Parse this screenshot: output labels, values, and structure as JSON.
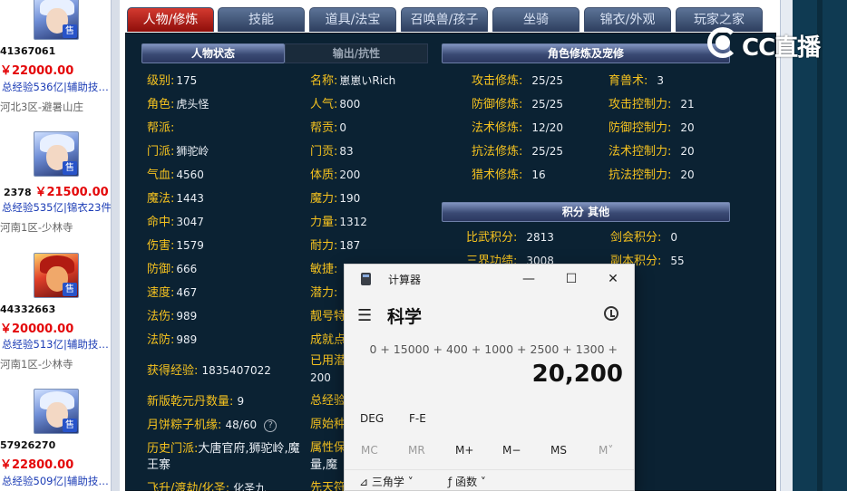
{
  "listings": [
    {
      "id": "41367061",
      "price": "￥22000.00",
      "exp": "总经验536亿|辅助技…",
      "server": "河北3区-避暑山庄",
      "badge": "售"
    },
    {
      "id": "2378",
      "price": "￥21500.00",
      "exp": "总经验535亿|锦衣23件",
      "server": "河南1区-少林寺",
      "badge": "售"
    },
    {
      "id": "44332663",
      "price": "￥20000.00",
      "exp": "总经验513亿|辅助技…",
      "server": "河南1区-少林寺",
      "badge": "售"
    },
    {
      "id": "57926270",
      "price": "￥22800.00",
      "exp": "总经验509亿|辅助技…",
      "server": "",
      "badge": "售"
    }
  ],
  "tabs": [
    "人物/修炼",
    "技能",
    "道具/法宝",
    "召唤兽/孩子",
    "坐骑",
    "锦衣/外观",
    "玩家之家"
  ],
  "sections": {
    "status": "人物状态",
    "output": "输出/抗性",
    "cultivation": "角色修炼及宠修",
    "points": "积分 其他"
  },
  "status_left": [
    {
      "k": "级别:",
      "v": "175"
    },
    {
      "k": "角色:",
      "v": "虎头怪"
    },
    {
      "k": "帮派:",
      "v": ""
    },
    {
      "k": "门派:",
      "v": "狮驼岭"
    },
    {
      "k": "气血:",
      "v": "4560"
    },
    {
      "k": "魔法:",
      "v": "1443"
    },
    {
      "k": "命中:",
      "v": "3047"
    },
    {
      "k": "伤害:",
      "v": "1579"
    },
    {
      "k": "防御:",
      "v": "666"
    },
    {
      "k": "速度:",
      "v": "467"
    },
    {
      "k": "法伤:",
      "v": "989"
    },
    {
      "k": "法防:",
      "v": "989"
    }
  ],
  "status_right": [
    {
      "k": "名称:",
      "v": "崽崽いRich"
    },
    {
      "k": "人气:",
      "v": "800"
    },
    {
      "k": "帮贡:",
      "v": "0"
    },
    {
      "k": "门贡:",
      "v": "83"
    },
    {
      "k": "体质:",
      "v": "200"
    },
    {
      "k": "魔力:",
      "v": "190"
    },
    {
      "k": "力量:",
      "v": "1312"
    },
    {
      "k": "耐力:",
      "v": "187"
    },
    {
      "k": "敏捷:",
      "v": ""
    },
    {
      "k": "潜力:",
      "v": ""
    },
    {
      "k": "靓号特",
      "v": ""
    },
    {
      "k": "成就点",
      "v": ""
    }
  ],
  "extra": {
    "exp_label": "获得经验:",
    "exp_value": "1835407022",
    "used_label": "已用潜",
    "used_value": "200",
    "qianyuan_label": "新版乾元丹数量:",
    "qianyuan_value": "9",
    "total_exp_label": "总经验",
    "mooncake_label": "月饼粽子机缘:",
    "mooncake_value": "48/60",
    "origin_label": "原始种",
    "history_label": "历史门派:",
    "history_value": "大唐官府,狮驼岭,魔王寨",
    "attr_label": "属性保",
    "attr_value": "量,魔",
    "fly_label": "飞升/渡劫/化圣:",
    "fly_value": "化圣九",
    "xian_label": "先天符",
    "help_icon": "?"
  },
  "cultivation": [
    {
      "k": "攻击修炼:",
      "v": "25/25",
      "k2": "育兽术:",
      "v2": "3"
    },
    {
      "k": "防御修炼:",
      "v": "25/25",
      "k2": "攻击控制力:",
      "v2": "21"
    },
    {
      "k": "法术修炼:",
      "v": "12/20",
      "k2": "防御控制力:",
      "v2": "20"
    },
    {
      "k": "抗法修炼:",
      "v": "25/25",
      "k2": "法术控制力:",
      "v2": "20"
    },
    {
      "k": "猎术修炼:",
      "v": "16",
      "k2": "抗法控制力:",
      "v2": "20"
    }
  ],
  "points": [
    {
      "k": "比武积分:",
      "v": "2813",
      "k2": "剑会积分:",
      "v2": "0"
    },
    {
      "k": "三界功绩:",
      "v": "3008",
      "k2": "副本积分:",
      "v2": "55"
    }
  ],
  "logo": {
    "text": "CC直播"
  },
  "calculator": {
    "title": "计算器",
    "mode": "科学",
    "expression": "0 + 15000 + 400 + 1000 + 2500 + 1300 +",
    "result": "20,200",
    "deg": "DEG",
    "fe": "F-E",
    "memory": [
      "MC",
      "MR",
      "M+",
      "M−",
      "MS",
      "M˅"
    ],
    "trig": "三角学",
    "func": "函数",
    "minimize": "—",
    "maximize": "☐",
    "close": "✕",
    "menu": "☰",
    "chev": "˅",
    "trig_icon": "⊿",
    "func_icon": "ƒ"
  }
}
